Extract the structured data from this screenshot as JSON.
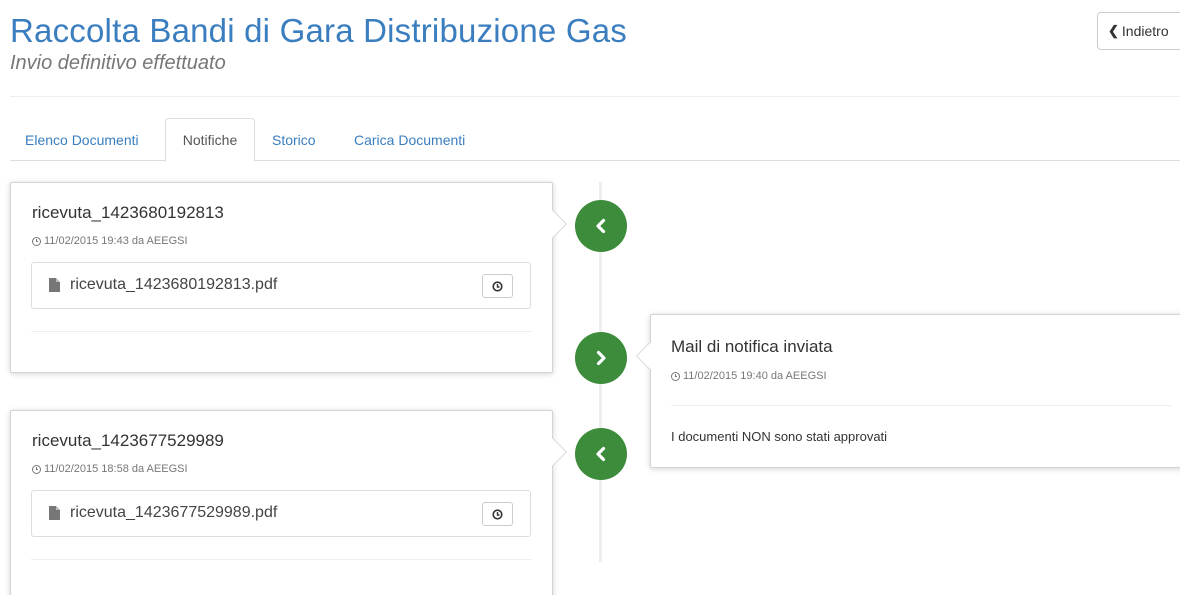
{
  "header": {
    "title": "Raccolta Bandi di Gara Distribuzione Gas",
    "subtitle": "Invio definitivo effettuato",
    "back_label": "Indietro"
  },
  "tabs": [
    {
      "label": "Elenco Documenti",
      "active": false
    },
    {
      "label": "Notifiche",
      "active": true
    },
    {
      "label": "Storico",
      "active": false
    },
    {
      "label": "Carica Documenti",
      "active": false
    }
  ],
  "timeline": [
    {
      "side": "left",
      "icon": "chevron-left-icon",
      "title": "ricevuta_1423680192813",
      "meta": "11/02/2015 19:43 da AEEGSI",
      "file": "ricevuta_1423680192813.pdf"
    },
    {
      "side": "right",
      "icon": "chevron-right-icon",
      "title": "Mail di notifica inviata",
      "meta": "11/02/2015 19:40 da AEEGSI",
      "body": "I documenti NON sono stati approvati"
    },
    {
      "side": "left",
      "icon": "chevron-left-icon",
      "title": "ricevuta_1423677529989",
      "meta": "11/02/2015 18:58 da AEEGSI",
      "file": "ricevuta_1423677529989.pdf"
    }
  ],
  "colors": {
    "accent": "#3a7ebf",
    "badge": "#3c8c3c"
  }
}
